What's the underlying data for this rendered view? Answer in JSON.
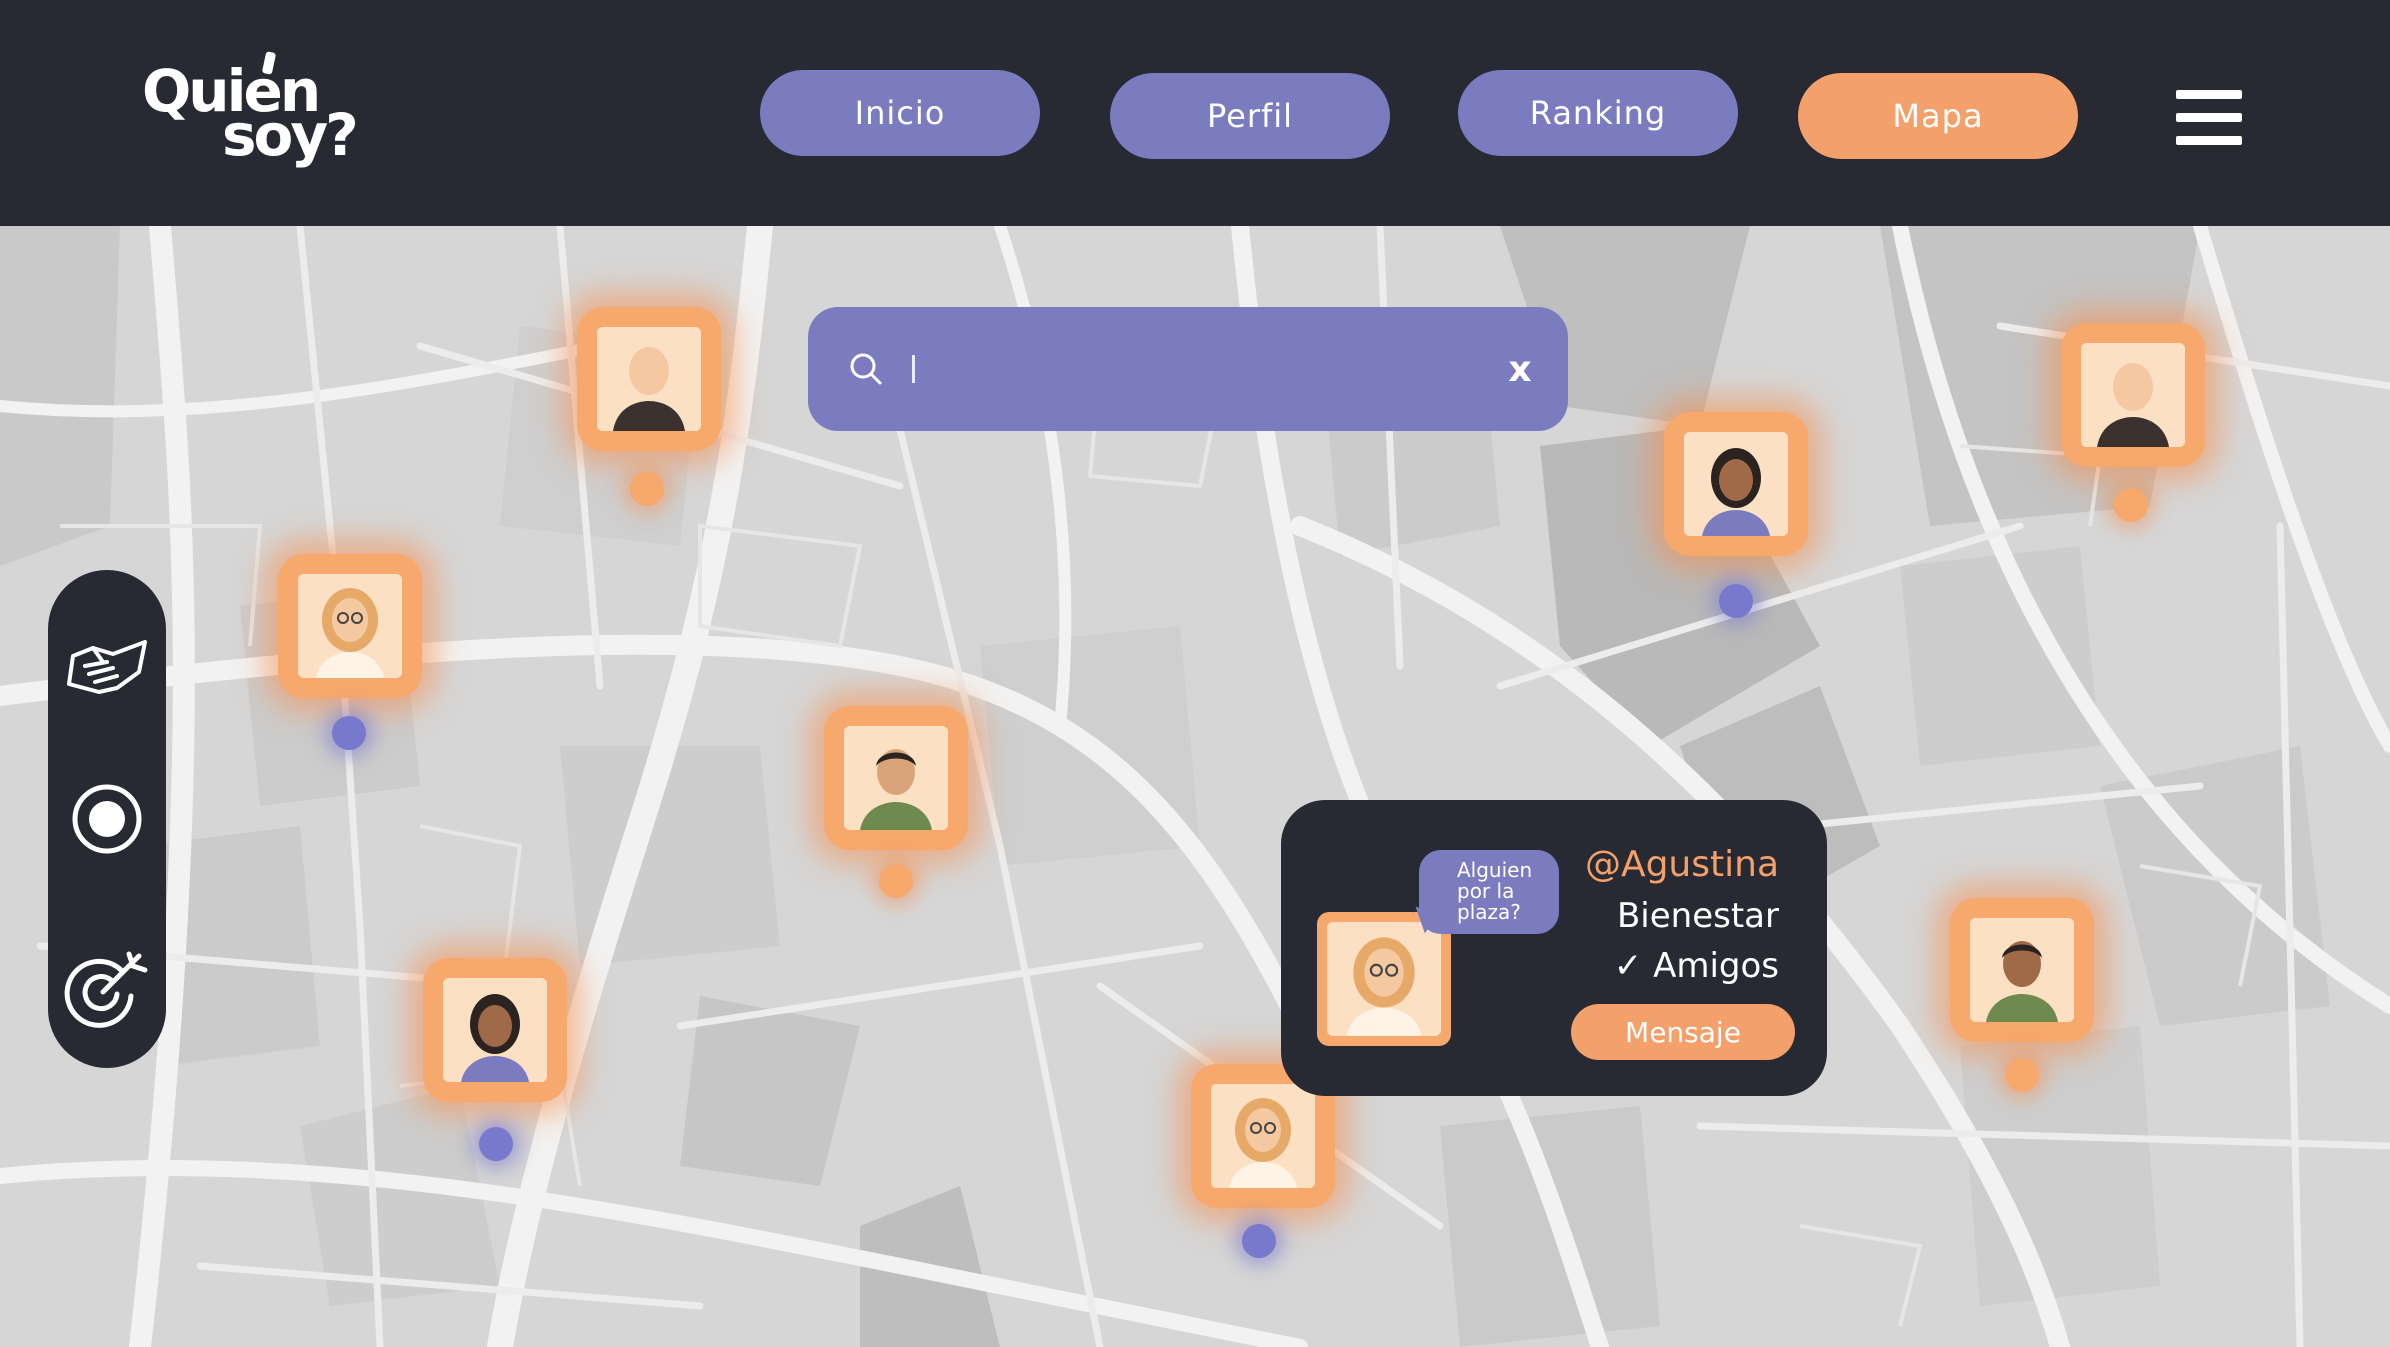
{
  "header": {
    "logo_line1": "Quien",
    "logo_line2": "soy?",
    "nav": [
      {
        "label": "Inicio",
        "active": false
      },
      {
        "label": "Perfil",
        "active": false
      },
      {
        "label": "Ranking",
        "active": false
      },
      {
        "label": "Mapa",
        "active": true
      }
    ],
    "menu_icon": "hamburger-menu-icon"
  },
  "search": {
    "value": "",
    "clear_label": "x",
    "icon": "search-icon"
  },
  "toolbar": {
    "items": [
      {
        "icon": "handshake-icon"
      },
      {
        "icon": "location-target-icon"
      },
      {
        "icon": "dart-target-icon"
      }
    ]
  },
  "profile_card": {
    "username": "@Agustina",
    "category": "Bienestar",
    "friend_status": "✓ Amigos",
    "bubble_line1": "Alguien",
    "bubble_line2": "por la",
    "bubble_line3": "plaza?",
    "message_button": "Mensaje"
  },
  "colors": {
    "header_bg": "#272a33",
    "accent_purple": "#7b7bbf",
    "accent_orange": "#f4a06a",
    "map_bg": "#dadada"
  }
}
